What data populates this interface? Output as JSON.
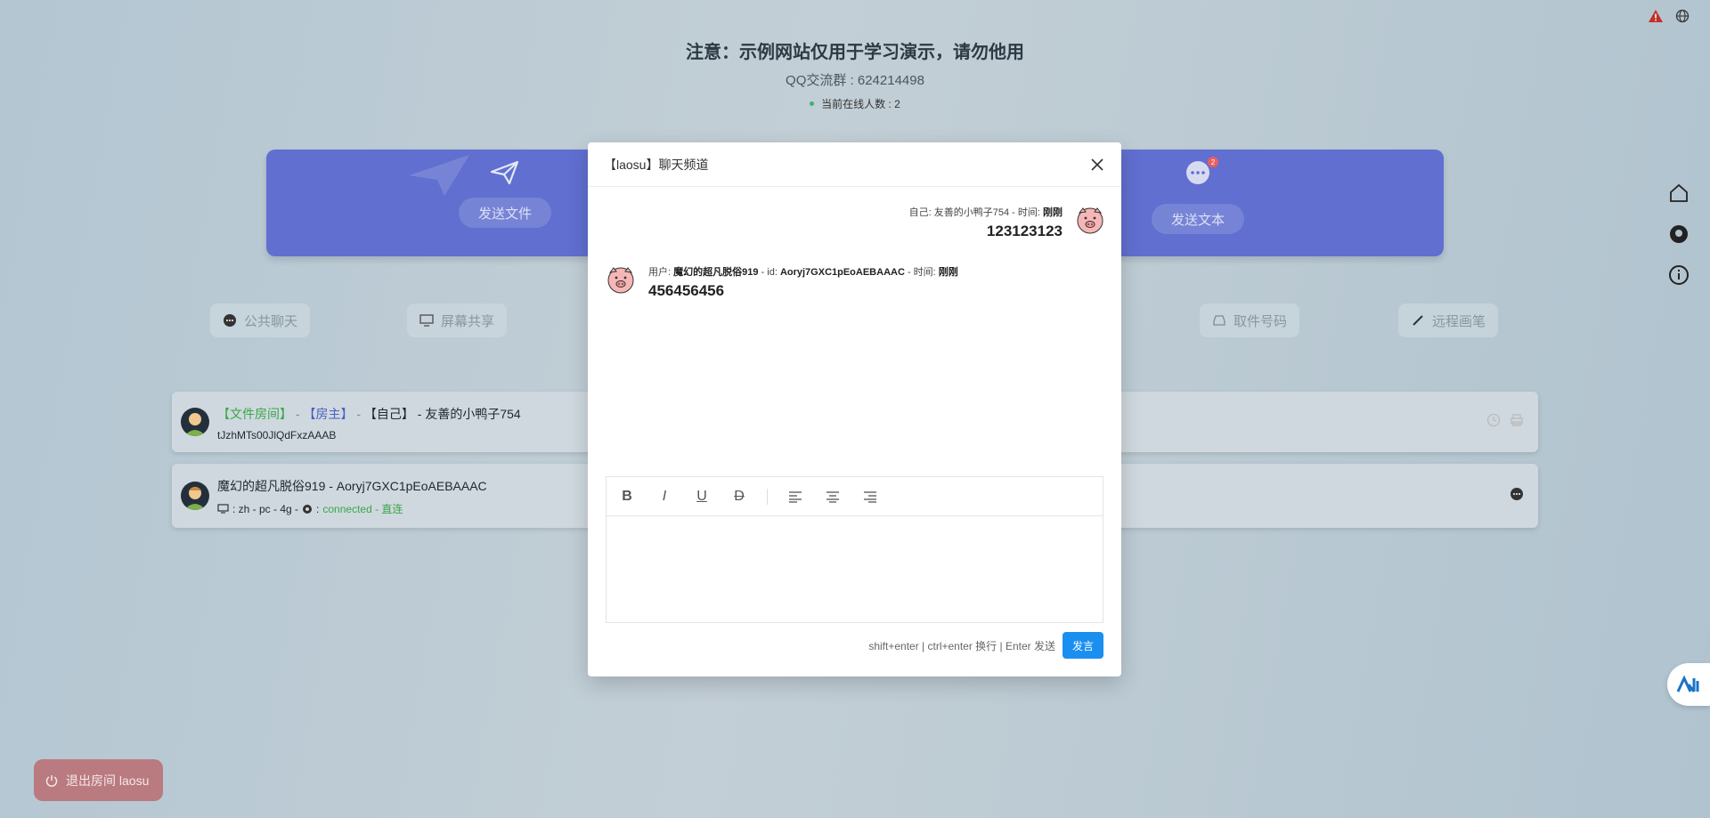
{
  "header": {
    "notice": "注意：示例网站仅用于学习演示，请勿他用",
    "qq_group": "QQ交流群 : 624214498",
    "online_count": "当前在线人数 : 2"
  },
  "panel": {
    "send_file": "发送文件",
    "send_text": "发送文本",
    "badge": "2"
  },
  "tools": {
    "public_chat": "公共聊天",
    "screen_share": "屏幕共享",
    "pickup_code": "取件号码",
    "remote_brush": "远程画笔"
  },
  "cards": [
    {
      "tag_room": "【文件房间】",
      "sep1": "-",
      "tag_owner": "【房主】",
      "sep2": "-",
      "tag_self": "【自己】",
      "name": "- 友善的小鸭子754",
      "id": "tJzhMTs00JlQdFxzAAAB"
    },
    {
      "title": "魔幻的超凡脱俗919 - Aoryj7GXC1pEoAEBAAAC",
      "info": ": zh - pc - 4g - ",
      "info2": ":",
      "status": "connected - 直连"
    }
  ],
  "exit_button": "退出房间 laosu",
  "modal": {
    "title": "【laosu】聊天频道",
    "messages": [
      {
        "meta_prefix": "自己: 友善的小鸭子754 - 时间: ",
        "meta_time": "刚刚",
        "text": "123123123"
      },
      {
        "meta_prefix": "用户: ",
        "meta_user": "魔幻的超凡脱俗919",
        "meta_mid": " - id: ",
        "meta_id": "Aoryj7GXC1pEoAEBAAAC",
        "meta_mid2": " - 时间: ",
        "meta_time": "刚刚",
        "text": "456456456"
      }
    ],
    "toolbar": {
      "bold": "B",
      "italic": "I",
      "underline": "U",
      "strike": "D"
    },
    "hint": "shift+enter | ctrl+enter 换行 | Enter 发送",
    "send": "发言"
  },
  "colors": {
    "panel": "#5968d0",
    "send_button": "#1a8ff0",
    "connected": "#3aa64a"
  }
}
